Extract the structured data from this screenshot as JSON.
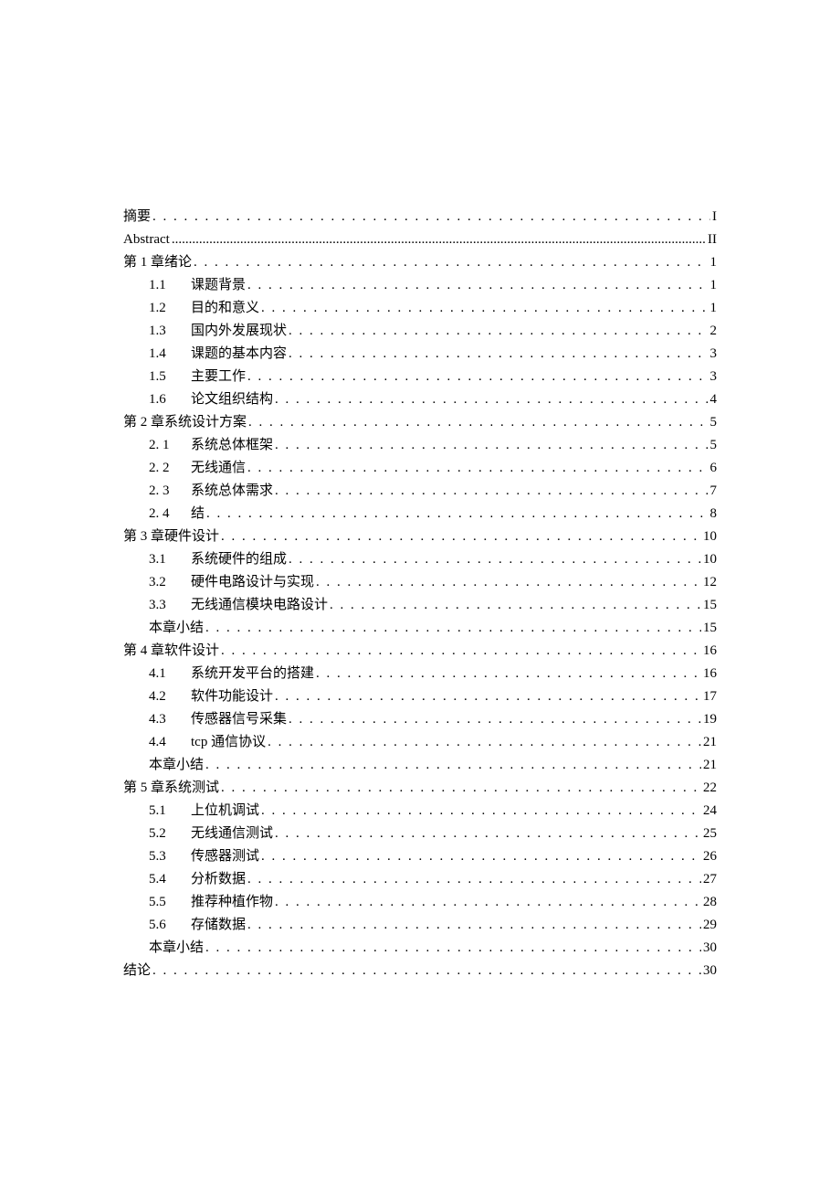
{
  "toc": [
    {
      "level": 0,
      "num": "",
      "title": "摘要",
      "page": "I",
      "dense": false
    },
    {
      "level": 0,
      "num": "",
      "title": "Abstract",
      "page": "II",
      "dense": true,
      "latin": true
    },
    {
      "level": 0,
      "num": "",
      "title": "第 1 章绪论",
      "page": "1",
      "dense": false
    },
    {
      "level": 1,
      "num": "1.1",
      "title": "课题背景",
      "page": "1",
      "dense": false
    },
    {
      "level": 1,
      "num": "1.2",
      "title": "目的和意义",
      "page": "1",
      "dense": false
    },
    {
      "level": 1,
      "num": "1.3",
      "title": "国内外发展现状",
      "page": "2",
      "dense": false
    },
    {
      "level": 1,
      "num": "1.4",
      "title": "课题的基本内容",
      "page": "3",
      "dense": false
    },
    {
      "level": 1,
      "num": "1.5",
      "title": "主要工作",
      "page": "3",
      "dense": false
    },
    {
      "level": 1,
      "num": "1.6",
      "title": "论文组织结构",
      "page": "4",
      "dense": false
    },
    {
      "level": 0,
      "num": "",
      "title": "第 2 章系统设计方案",
      "page": "5",
      "dense": false
    },
    {
      "level": 1,
      "num": "2. 1",
      "title": "系统总体框架",
      "page": "5",
      "dense": false
    },
    {
      "level": 1,
      "num": "2. 2",
      "title": "无线通信",
      "page": "6",
      "dense": false
    },
    {
      "level": 1,
      "num": "2. 3",
      "title": "系统总体需求",
      "page": "7",
      "dense": false
    },
    {
      "level": 1,
      "num": "2. 4",
      "title": "      结",
      "page": "8",
      "dense": false
    },
    {
      "level": 0,
      "num": "",
      "title": "第 3 章硬件设计",
      "page": "10",
      "dense": false
    },
    {
      "level": 1,
      "num": "3.1",
      "title": "系统硬件的组成",
      "page": "10",
      "dense": false
    },
    {
      "level": 1,
      "num": "3.2",
      "title": "硬件电路设计与实现",
      "page": "12",
      "dense": false
    },
    {
      "level": 1,
      "num": "3.3",
      "title": "无线通信模块电路设计",
      "page": "15",
      "dense": false
    },
    {
      "level": 1,
      "num": "",
      "title": "本章小结",
      "page": "15",
      "dense": false
    },
    {
      "level": 0,
      "num": "",
      "title": "第 4 章软件设计",
      "page": "16",
      "dense": false
    },
    {
      "level": 1,
      "num": "4.1",
      "title": "系统开发平台的搭建",
      "page": "16",
      "dense": false
    },
    {
      "level": 1,
      "num": "4.2",
      "title": "软件功能设计",
      "page": "17",
      "dense": false
    },
    {
      "level": 1,
      "num": "4.3",
      "title": "传感器信号采集",
      "page": "19",
      "dense": false
    },
    {
      "level": 1,
      "num": "4.4",
      "title": "tcp 通信协议",
      "page": "21",
      "dense": false
    },
    {
      "level": 1,
      "num": "",
      "title": "本章小结",
      "page": "21",
      "dense": false
    },
    {
      "level": 0,
      "num": "",
      "title": "第 5 章系统测试",
      "page": "22",
      "dense": false
    },
    {
      "level": 1,
      "num": "5.1",
      "title": "上位机调试",
      "page": "24",
      "dense": false
    },
    {
      "level": 1,
      "num": "5.2",
      "title": "无线通信测试",
      "page": "25",
      "dense": false
    },
    {
      "level": 1,
      "num": "5.3",
      "title": "传感器测试",
      "page": "26",
      "dense": false
    },
    {
      "level": 1,
      "num": "5.4",
      "title": "分析数据",
      "page": "27",
      "dense": false
    },
    {
      "level": 1,
      "num": "5.5",
      "title": "推荐种植作物",
      "page": "28",
      "dense": false
    },
    {
      "level": 1,
      "num": "5.6",
      "title": "存储数据",
      "page": "29",
      "dense": false
    },
    {
      "level": 1,
      "num": "",
      "title": "本章小结",
      "page": "30",
      "dense": false
    },
    {
      "level": 0,
      "num": "",
      "title": "结论",
      "page": "30",
      "dense": false
    }
  ]
}
